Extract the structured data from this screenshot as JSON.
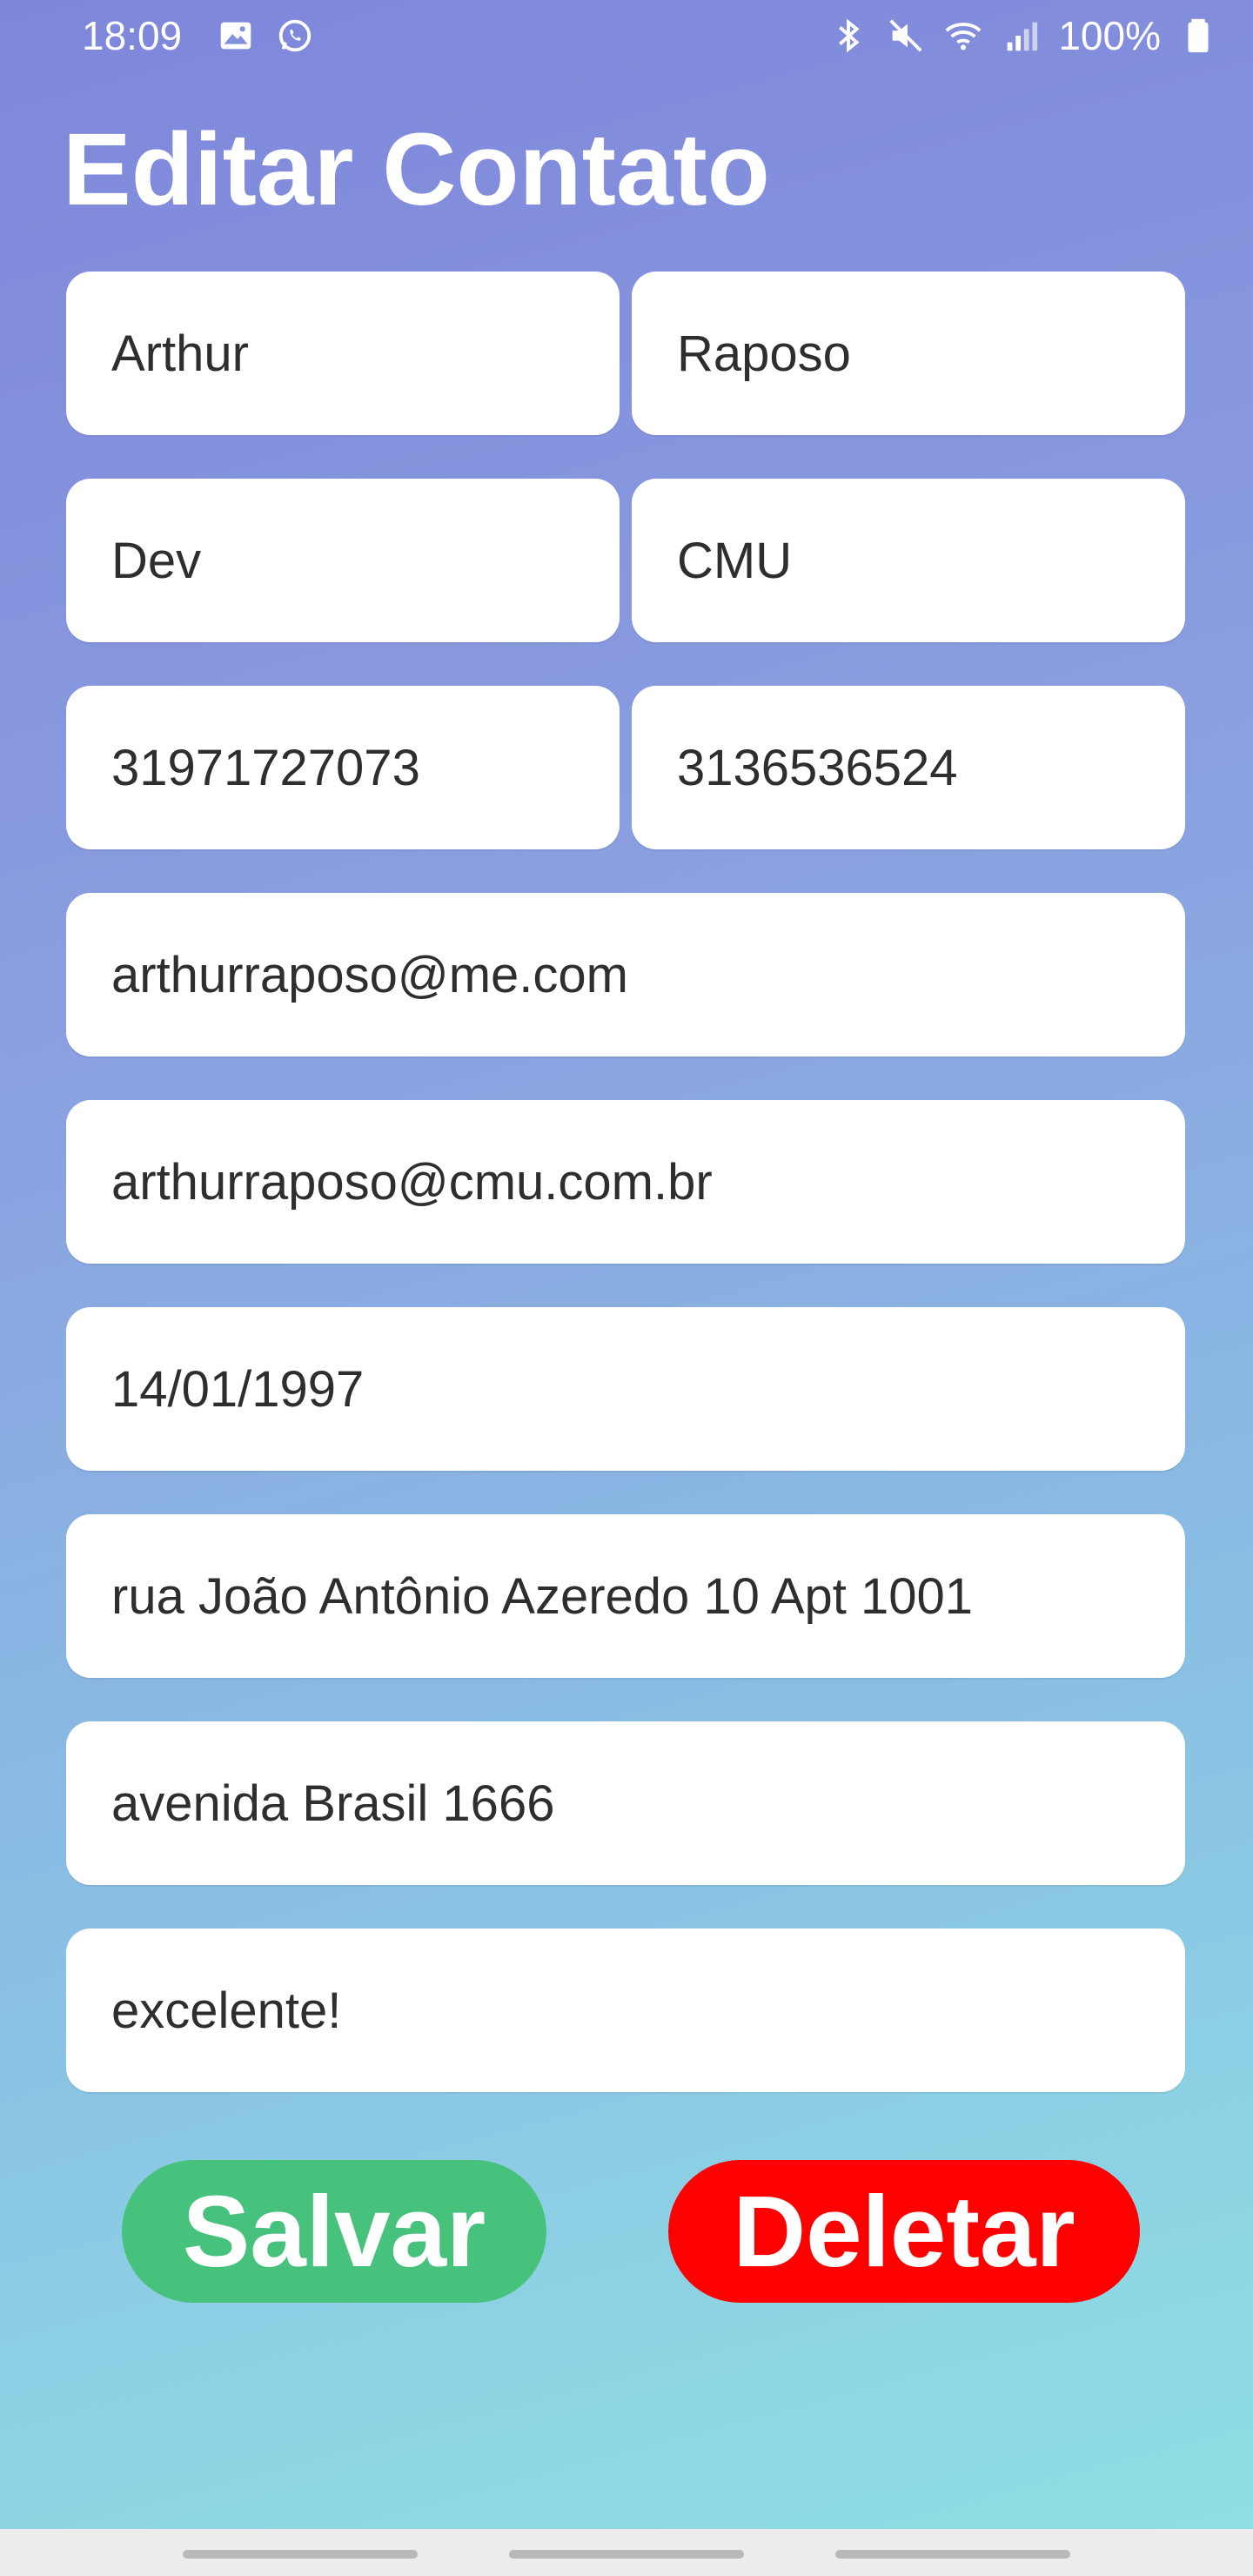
{
  "status_bar": {
    "time": "18:09",
    "left_icons": [
      "image-icon",
      "whatsapp-icon"
    ],
    "right_icons": [
      "bluetooth-icon",
      "mute-icon",
      "wifi-icon",
      "signal-icon"
    ],
    "battery": "100%"
  },
  "page": {
    "title": "Editar Contato"
  },
  "form": {
    "first_name": "Arthur",
    "last_name": "Raposo",
    "job": "Dev",
    "company": "CMU",
    "phone_1": "31971727073",
    "phone_2": "3136536524",
    "email_1": "arthurraposo@me.com",
    "email_2": "arthurraposo@cmu.com.br",
    "birthday": "14/01/1997",
    "address_1": "rua João Antônio Azeredo 10 Apt 1001",
    "address_2": "avenida Brasil 1666",
    "notes": "excelente!"
  },
  "actions": {
    "save_label": "Salvar",
    "delete_label": "Deletar"
  },
  "colors": {
    "save": "#46c27c",
    "delete": "#ff0000",
    "gradient_top": "#7e86da",
    "gradient_bottom": "#8fe2e3"
  }
}
